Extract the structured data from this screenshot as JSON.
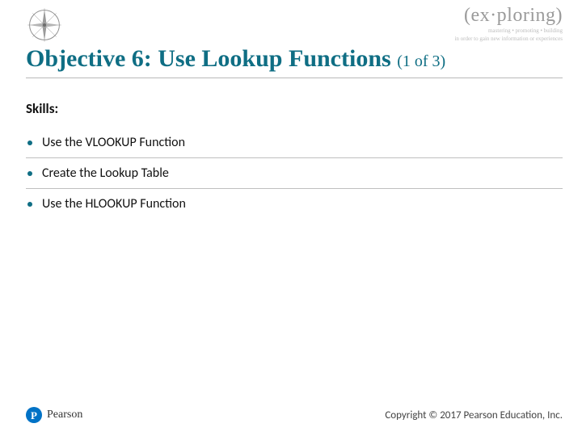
{
  "brand": {
    "word": "(ex·ploring)",
    "tagline1": "mastering • promoting • building",
    "tagline2": "in order to gain new information or experiences"
  },
  "title": {
    "main": "Objective 6: Use Lookup Functions",
    "counter": "(1 of 3)"
  },
  "skills_label": "Skills:",
  "bullets": [
    "Use the VLOOKUP Function",
    "Create the Lookup Table",
    "Use the HLOOKUP Function"
  ],
  "footer": {
    "publisher_initial": "P",
    "publisher_name": "Pearson",
    "copyright": "Copyright © 2017 Pearson Education, Inc."
  }
}
